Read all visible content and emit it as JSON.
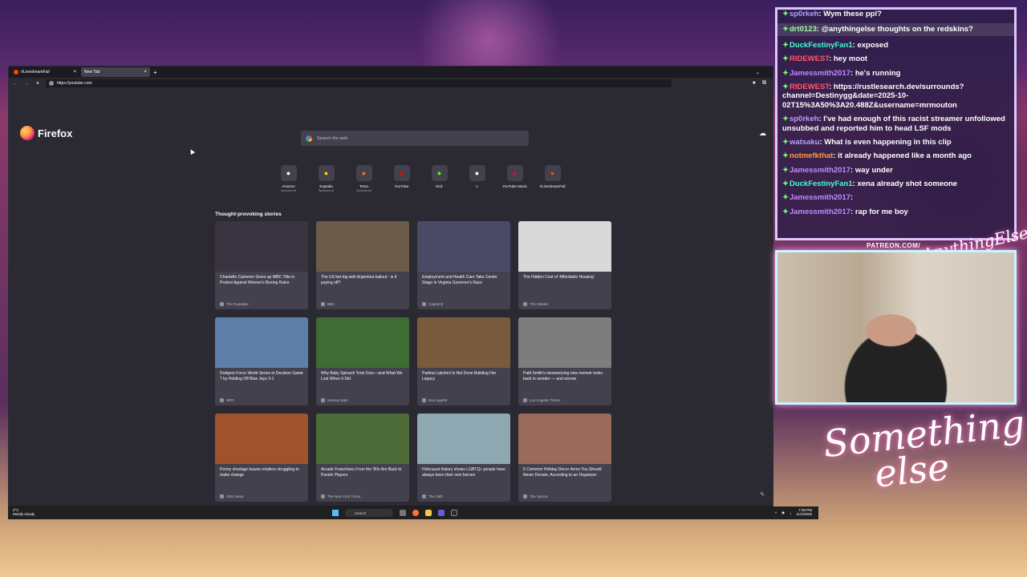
{
  "browser": {
    "tabs": [
      {
        "label": "r/LivestreamFail",
        "active": false
      },
      {
        "label": "New Tab",
        "active": true
      }
    ],
    "url": "https://youtube.com",
    "brand": "Firefox",
    "search_placeholder": "Search the web",
    "shortcuts": [
      {
        "label": "Amazon",
        "sub": "Sponsored",
        "icon": "amazon-icon",
        "color": "#ffffff"
      },
      {
        "label": "Expedia",
        "sub": "Sponsored",
        "icon": "expedia-icon",
        "color": "#ffd100"
      },
      {
        "label": "Temu",
        "sub": "Sponsored",
        "icon": "temu-icon",
        "color": "#fb7701"
      },
      {
        "label": "YouTube",
        "sub": "",
        "icon": "youtube-icon",
        "color": "#ff0000"
      },
      {
        "label": "Kick",
        "sub": "",
        "icon": "kick-icon",
        "color": "#53fc18"
      },
      {
        "label": "x",
        "sub": "",
        "icon": "x-icon",
        "color": "#ffffff"
      },
      {
        "label": "YouTube Music",
        "sub": "",
        "icon": "youtube-music-icon",
        "color": "#ff0033"
      },
      {
        "label": "r/LivestreamFail",
        "sub": "",
        "icon": "reddit-icon",
        "color": "#ff4500"
      }
    ],
    "section_title": "Thought-provoking stories",
    "stories": [
      {
        "title": "Chantelle Cameron Gives up WBC Title in Protest Against Women's Boxing Rules",
        "source": "The Guardian",
        "color": "#3a3340"
      },
      {
        "title": "The US bet big with Argentina bailout - is it paying off?",
        "source": "BBC",
        "color": "#6b5c4a"
      },
      {
        "title": "Employment and Health Care Take Center Stage in Virginia Governor's Race",
        "source": "Capital B",
        "color": "#4a4a66"
      },
      {
        "title": "The Hidden Cost of 'Affordable Housing'",
        "source": "The Atlantic",
        "color": "#d9d9d9"
      },
      {
        "title": "Dodgers Force World Series to Decisive Game 7 by Holding Off Blue Jays 3-1",
        "source": "NPR",
        "color": "#5d7fa8"
      },
      {
        "title": "Why Baby Spinach Took Over—and What We Lost When It Did",
        "source": "Serious Eats",
        "color": "#3f6b34"
      },
      {
        "title": "Padma Lakshmi Is Not Done Building Her Legacy",
        "source": "Bon Appétit",
        "color": "#7a5a3c"
      },
      {
        "title": "Patti Smith's mesmerizing new memoir looks back in wonder — and sorrow",
        "source": "Los Angeles Times",
        "color": "#7d7d7d"
      },
      {
        "title": "Penny shortage leaves retailers struggling to make change",
        "source": "CBS News",
        "color": "#a0522d"
      },
      {
        "title": "Arcade Franchises From the '80s Are Back to Punish Players",
        "source": "The New York Times",
        "color": "#4e6b3a"
      },
      {
        "title": "Holocaust history shows LGBTQ+ people have always been their own heroes",
        "source": "The 19th",
        "color": "#8ea7b0"
      },
      {
        "title": "5 Common Holiday Decor Items You Should Never Donate, According to an Organizer",
        "source": "The Spruce",
        "color": "#9a6b5a"
      }
    ],
    "partial_row_colors": [
      "#8b6a4a",
      "#3e4e36",
      "#c28a4a",
      "#a05a3a"
    ]
  },
  "taskbar": {
    "weather_temp": "4°C",
    "weather_desc": "Mostly cloudy",
    "search_label": "Search",
    "time": "7:36 PM",
    "date": "11/1/2025"
  },
  "chat": {
    "messages": [
      {
        "user": "sp0rkeh",
        "text": "Wym these ppl?",
        "color": "#b8a0ff",
        "highlight": false
      },
      {
        "user": "drt0123",
        "text": "@anythingelse thoughts on the redskins?",
        "color": "#9fff9f",
        "highlight": true
      },
      {
        "user": "DuckFestinyFan1",
        "text": "exposed",
        "color": "#3fffd0",
        "highlight": false
      },
      {
        "user": "RIDEWEST",
        "text": "hey moot",
        "color": "#ff5a6a",
        "highlight": false
      },
      {
        "user": "Jamessmith2017",
        "text": "he's running",
        "color": "#c08cff",
        "highlight": false
      },
      {
        "user": "RIDEWEST",
        "text": "https://rustlesearch.dev/surrounds?channel=Destinygg&date=2025-10-02T15%3A50%3A20.488Z&username=mrmouton",
        "color": "#ff5a6a",
        "highlight": false
      },
      {
        "user": "sp0rkeh",
        "text": "I've had enough of this racist streamer unfollowed unsubbed and reported him to head LSF mods",
        "color": "#b8a0ff",
        "highlight": false
      },
      {
        "user": "watsaku",
        "text": "What is even happening in this clip",
        "color": "#b8a0ff",
        "highlight": false
      },
      {
        "user": "notmefkthat",
        "text": "it already happened like a month ago",
        "color": "#ff9d3a",
        "highlight": false
      },
      {
        "user": "Jamessmith2017",
        "text": "way under",
        "color": "#c08cff",
        "highlight": false
      },
      {
        "user": "DuckFestinyFan1",
        "text": "xena already shot someone",
        "color": "#3fffd0",
        "highlight": false
      },
      {
        "user": "Jamessmith2017",
        "text": "",
        "color": "#c08cff",
        "highlight": false
      },
      {
        "user": "Jamessmith2017",
        "text": "rap for me boy",
        "color": "#c08cff",
        "highlight": false
      }
    ]
  },
  "overlay": {
    "patreon": "PATREON.COM/",
    "brand_line1": "Something",
    "brand_line2": "else",
    "brand_small": "AnythingElse"
  }
}
